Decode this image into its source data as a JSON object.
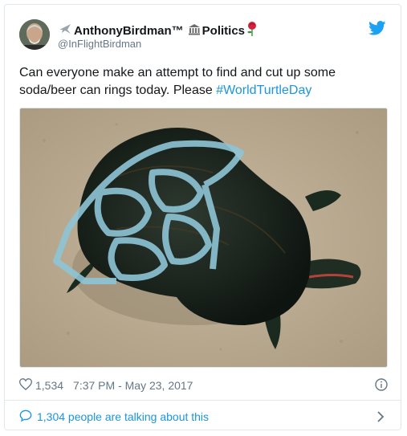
{
  "tweet": {
    "display_name": "AnthonyBirdman™",
    "name_suffix": "Politics",
    "handle": "@InFlightBirdman",
    "text": "Can everyone make an attempt to find and cut up some soda/beer can rings today. Please ",
    "hashtag": "#WorldTurtleDay",
    "likes": "1,534",
    "timestamp": "7:37 PM - May 23, 2017",
    "talking": "1,304 people are talking about this"
  },
  "icons": {
    "brand": "twitter-bird-icon",
    "like": "heart-icon",
    "info": "info-icon",
    "reply": "speech-bubble-icon",
    "chevron": "chevron-right-icon",
    "name_emoji_1": "airplane-icon",
    "name_emoji_2": "classical-building-icon",
    "name_emoji_3": "rose-icon"
  },
  "colors": {
    "accent": "#1b95e0",
    "muted": "#657786",
    "text": "#14171a",
    "border": "#e1e8ed"
  }
}
